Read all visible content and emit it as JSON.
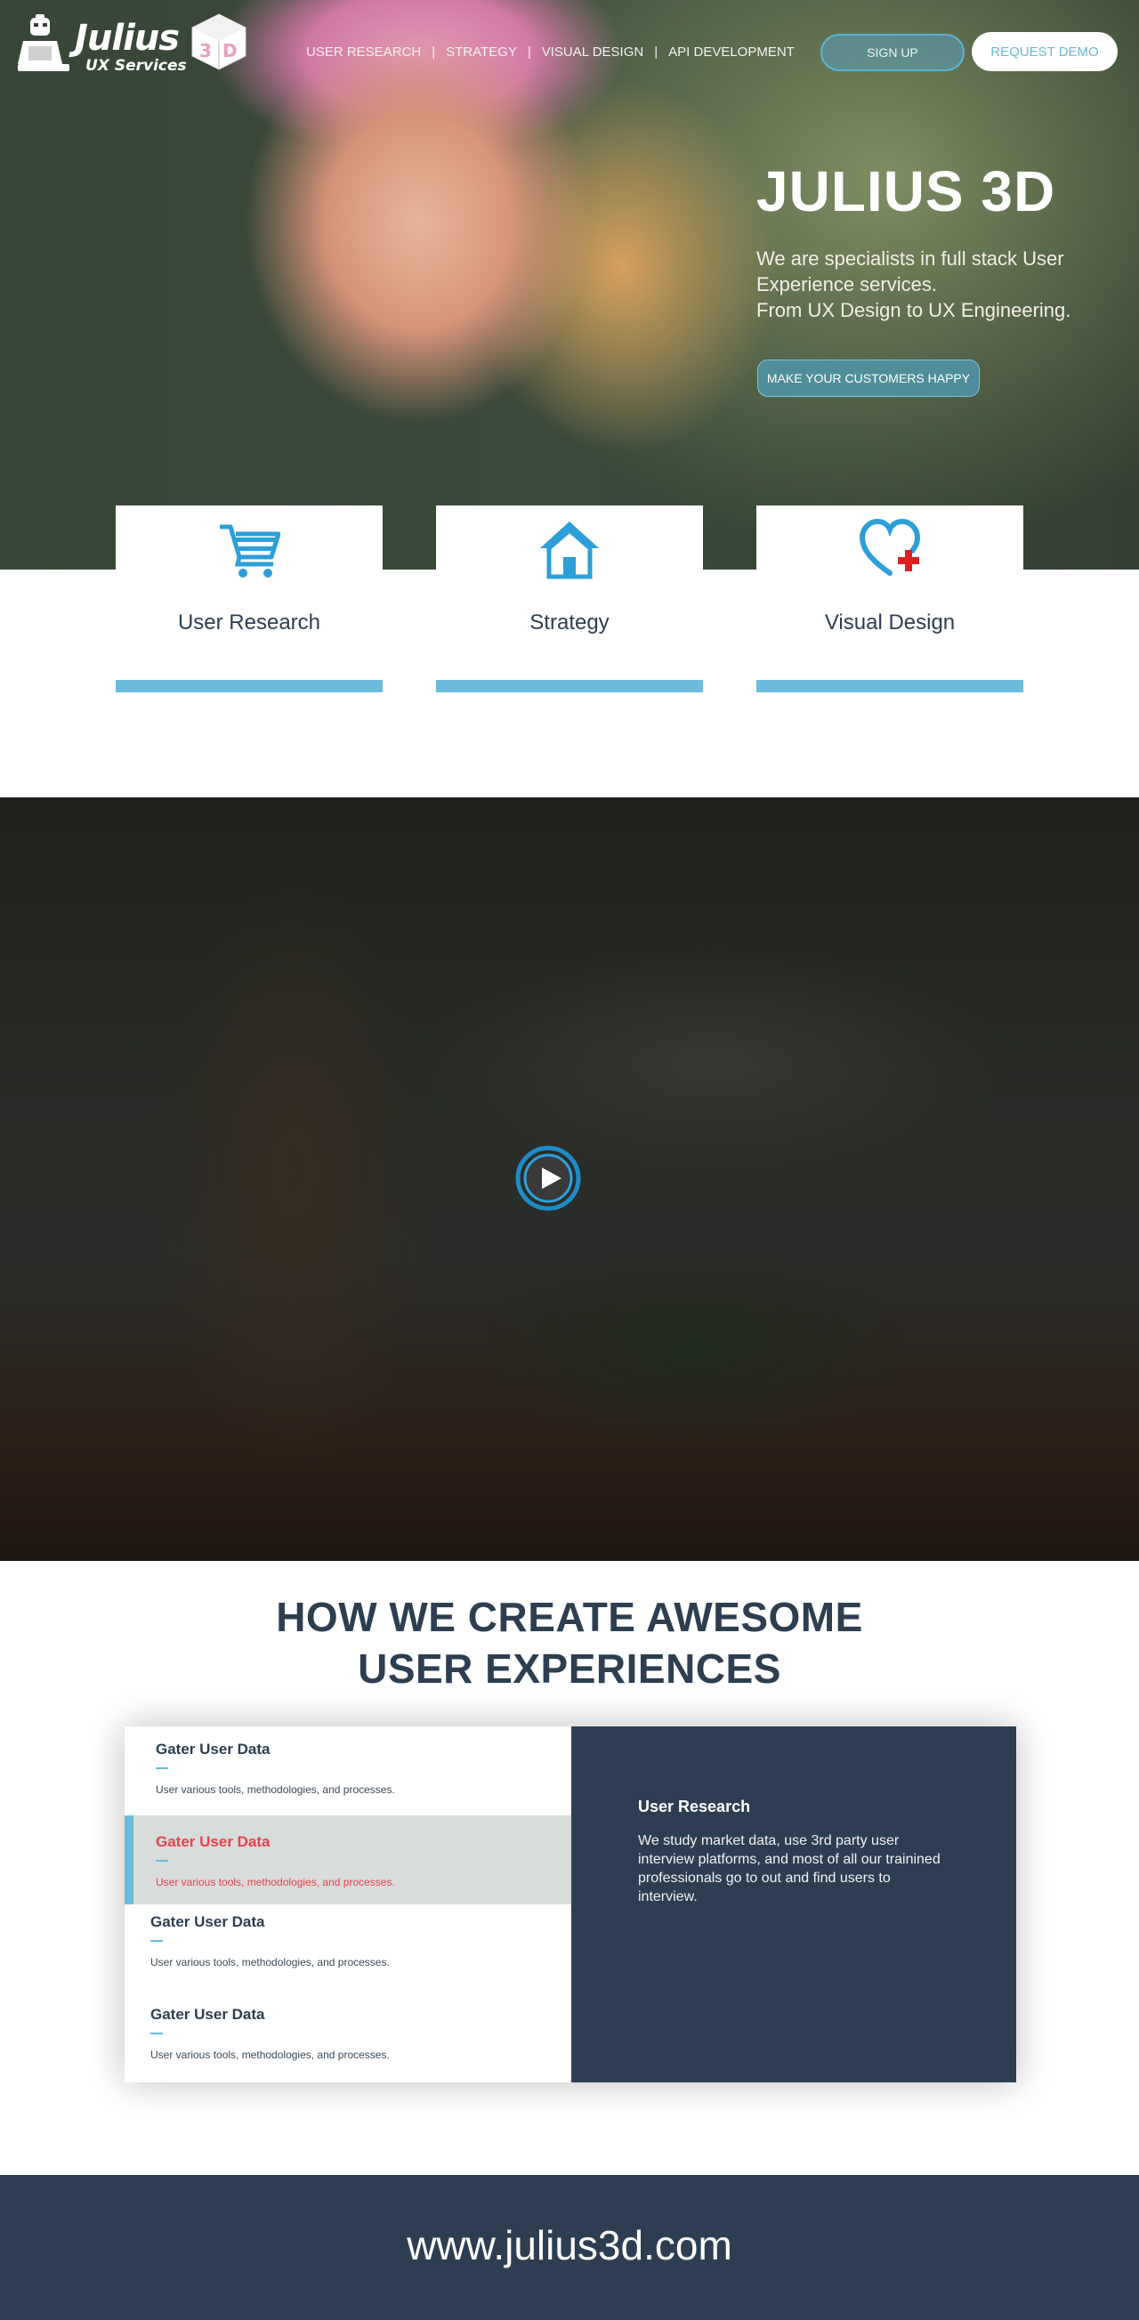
{
  "brand": {
    "name": "Julius",
    "tagline": "UX Services",
    "cube_letters": "3D"
  },
  "nav": {
    "items": [
      {
        "label": "USER RESEARCH"
      },
      {
        "label": "STRATEGY"
      },
      {
        "label": "VISUAL DESIGN"
      },
      {
        "label": "API DEVELOPMENT"
      }
    ],
    "separator": "|",
    "signup_label": "SIGN UP",
    "demo_label": "REQUEST DEMO"
  },
  "hero": {
    "title": "JULIUS 3D",
    "subtitle_line1": "We are specialists in full stack User Experience services.",
    "subtitle_line2": "From UX Design to UX Engineering.",
    "cta_label": "MAKE YOUR CUSTOMERS HAPPY"
  },
  "services": [
    {
      "label": "User Research",
      "icon": "shopping-cart-icon"
    },
    {
      "label": "Strategy",
      "icon": "house-icon"
    },
    {
      "label": "Visual Design",
      "icon": "heart-plus-icon"
    }
  ],
  "video": {
    "play_icon": "play-icon"
  },
  "how": {
    "title_line1": "HOW WE CREATE AWESOME",
    "title_line2": "USER EXPERIENCES",
    "steps": [
      {
        "title": "Gater User Data",
        "desc": "User various tools, methodologies, and processes."
      },
      {
        "title": "Gater User Data",
        "desc": "User various tools, methodologies, and processes."
      },
      {
        "title": "Gater User Data",
        "desc": "User various tools, methodologies, and processes."
      },
      {
        "title": "Gater User Data",
        "desc": "User various tools, methodologies, and processes."
      }
    ],
    "active_step": 2,
    "detail": {
      "title": "User Research",
      "body": "We study market data, use 3rd party user interview platforms, and most of all our trainined professionals go to out and find users to interview."
    }
  },
  "footer": {
    "url": "www.julius3d.com"
  },
  "colors": {
    "accent": "#6bbcdc",
    "navy": "#2e3e52",
    "highlight": "#e8424e",
    "icon_blue": "#2d9fd8",
    "icon_red": "#e02020"
  }
}
